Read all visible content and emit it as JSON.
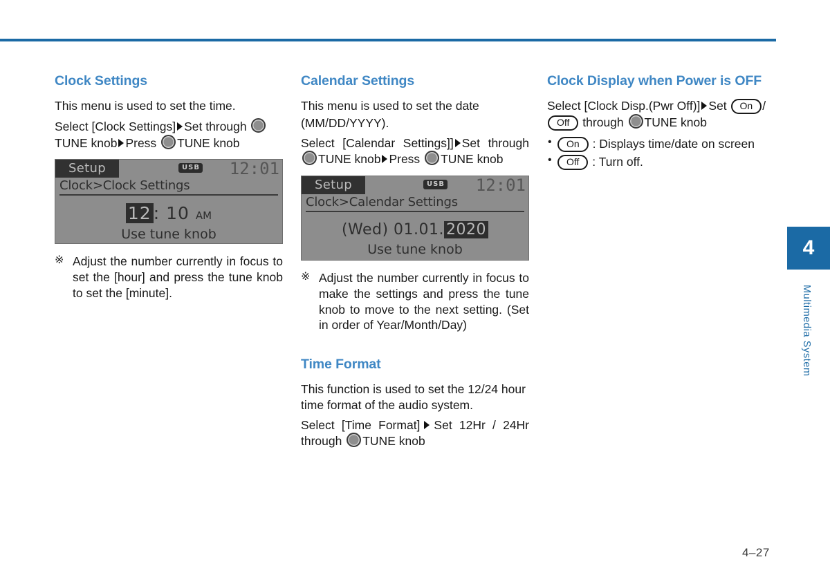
{
  "page": {
    "number": "4–27",
    "chapter_number": "4",
    "chapter_label": "Multimedia System",
    "accent_color": "#1b6aa5",
    "heading_color": "#3f87c4"
  },
  "column_1": {
    "title": "Clock Settings",
    "intro": "This menu is used to set the time.",
    "instruction": {
      "part1": "Select [Clock Settings]",
      "part2": "Set through",
      "part3": "TUNE knob",
      "part4": "Press",
      "part5": "TUNE knob"
    },
    "screen": {
      "setup_label": "Setup",
      "source_badge": "USB",
      "clock": "12:01",
      "breadcrumb": "Clock>Clock Settings",
      "value_highlighted": "12",
      "value_separator": ":",
      "value_rest": "10",
      "value_ampm": "AM",
      "hint": "Use tune knob"
    },
    "note_mark": "※",
    "note": "Adjust the number currently in focus to set the [hour] and press the tune knob to set the [minute]."
  },
  "column_2": {
    "title": "Calendar Settings",
    "intro_line1": "This menu is used to set the date",
    "intro_line2": "(MM/DD/YYYY).",
    "instruction": {
      "part1": "Select  [Calendar  Settings]]",
      "part2": "Set through",
      "part3": "TUNE knob",
      "part4": "Press",
      "part5": "TUNE knob"
    },
    "screen": {
      "setup_label": "Setup",
      "source_badge": "USB",
      "clock": "12:01",
      "breadcrumb": "Clock>Calendar Settings",
      "value_prefix": "(Wed) 01.01.",
      "value_highlighted": "2020",
      "hint": "Use tune knob"
    },
    "note_mark": "※",
    "note": "Adjust the number currently in focus to make the settings and press the tune knob to move to the next setting. (Set in order of Year/Month/Day)",
    "time_format": {
      "title": "Time Format",
      "intro": "This function is used to set the 12/24 hour time format of the audio system.",
      "instruction_part1": "Select [Time Format]",
      "instruction_part2": "Set 12Hr / 24Hr through",
      "instruction_part3": "TUNE knob"
    }
  },
  "column_3": {
    "title": "Clock Display when Power is OFF",
    "instruction": {
      "part1": "Select  [Clock  Disp.(Pwr  Off)]",
      "part2": "Set",
      "on_label": "On",
      "slash": "/",
      "off_label": "Off",
      "part3": "through",
      "part4": "TUNE knob"
    },
    "bullets": [
      {
        "pill": "On",
        "text": ": Displays time/date on screen"
      },
      {
        "pill": "Off",
        "text": ": Turn off."
      }
    ]
  }
}
